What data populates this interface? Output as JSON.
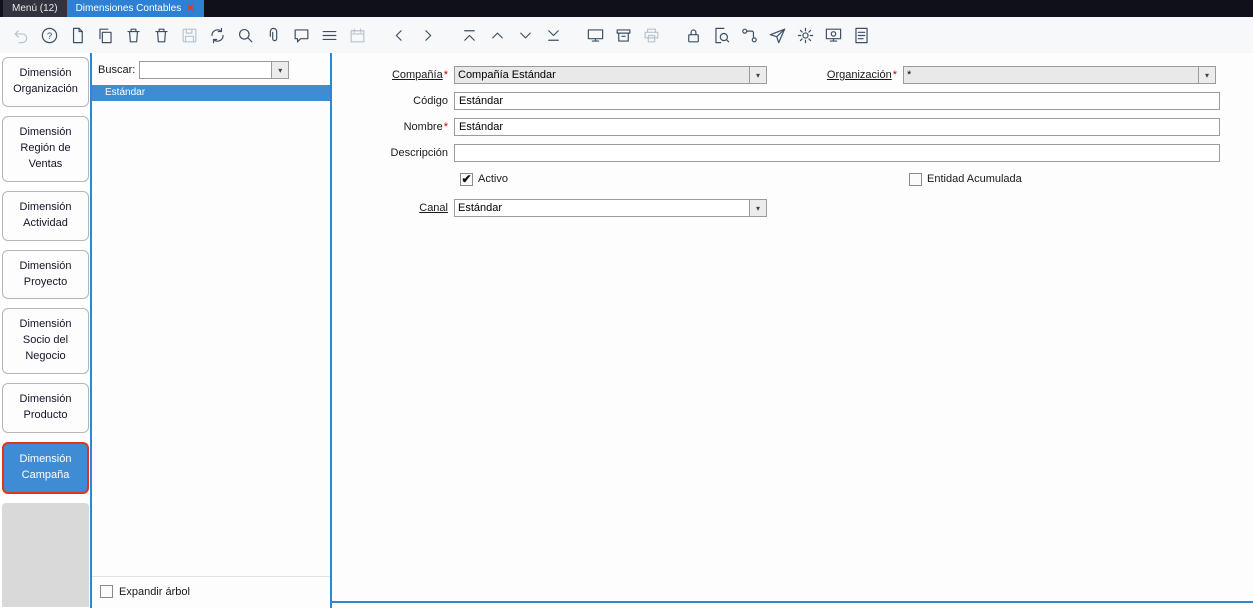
{
  "window_tabs": {
    "menu_label": "Menú (12)",
    "active_label": "Dimensiones Contables"
  },
  "ui": {
    "dropdown_glyph": "▾",
    "close_glyph": "✕",
    "check_glyph": "✔"
  },
  "toolbar": {
    "icons": [
      "undo",
      "help",
      "new-record",
      "copy-record",
      "delete-record",
      "delete-selection",
      "save",
      "refresh",
      "find",
      "attachment",
      "chat",
      "grid-toggle",
      "calendar",
      "back",
      "forward",
      "first-record",
      "previous-record",
      "next-record",
      "last-record",
      "report",
      "archive",
      "print",
      "lock",
      "zoom-across",
      "workflow",
      "request",
      "settings",
      "product-info",
      "help-log"
    ],
    "disabled_icons": [
      "undo",
      "save",
      "calendar",
      "print"
    ]
  },
  "sidebar": {
    "tabs": [
      {
        "label": "Dimensión Organización",
        "active": false
      },
      {
        "label": "Dimensión Región de Ventas",
        "active": false
      },
      {
        "label": "Dimensión Actividad",
        "active": false
      },
      {
        "label": "Dimensión Proyecto",
        "active": false
      },
      {
        "label": "Dimensión Socio del Negocio",
        "active": false
      },
      {
        "label": "Dimensión Producto",
        "active": false
      },
      {
        "label": "Dimensión Campaña",
        "active": true
      }
    ]
  },
  "search_panel": {
    "buscar_label": "Buscar:",
    "search_value": "",
    "tree_items": [
      {
        "label": "Estándar",
        "selected": true
      }
    ],
    "expand_label": "Expandir árbol",
    "expand_checked": false
  },
  "form": {
    "required_marker": "*",
    "compania_label": "Compañía",
    "compania_value": "Compañía Estándar",
    "organizacion_label": "Organización",
    "organizacion_value": "*",
    "codigo_label": "Código",
    "codigo_value": "Estándar",
    "nombre_label": "Nombre",
    "nombre_value": "Estándar",
    "descripcion_label": "Descripción",
    "descripcion_value": "",
    "activo_label": "Activo",
    "activo_checked": true,
    "entidad_label": "Entidad Acumulada",
    "entidad_checked": false,
    "canal_label": "Canal",
    "canal_value": "Estándar"
  },
  "colors": {
    "accent_blue": "#2f86d2",
    "selection_blue": "#3f8cd5",
    "annotation_red": "#e0351b",
    "topbar_dark": "#10101a",
    "tab_active_blue": "#2e80d2"
  }
}
